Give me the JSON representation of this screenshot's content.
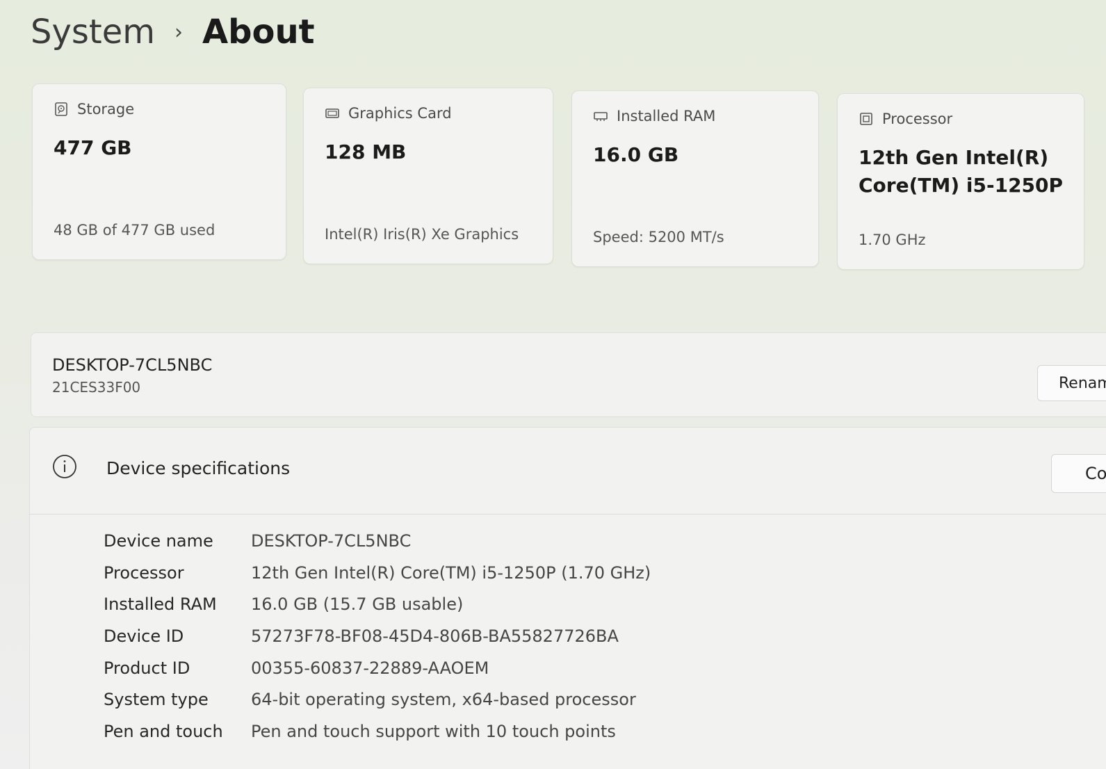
{
  "breadcrumb": {
    "parent": "System",
    "separator": "›",
    "current": "About"
  },
  "cards": [
    {
      "icon": "storage-icon",
      "label": "Storage",
      "value": "477 GB",
      "sub": "48 GB of 477 GB used"
    },
    {
      "icon": "graphics-card-icon",
      "label": "Graphics Card",
      "value": "128 MB",
      "sub": "Intel(R) Iris(R) Xe Graphics"
    },
    {
      "icon": "ram-icon",
      "label": "Installed RAM",
      "value": "16.0 GB",
      "sub": "Speed: 5200 MT/s"
    },
    {
      "icon": "processor-icon",
      "label": "Processor",
      "value_line1": "12th Gen Intel(R)",
      "value_line2": "Core(TM) i5-1250P",
      "sub": "1.70 GHz"
    }
  ],
  "device": {
    "name": "DESKTOP-7CL5NBC",
    "model": "21CES33F00",
    "rename_label": "Renam"
  },
  "specs": {
    "title": "Device specifications",
    "copy_label": "Co",
    "rows": [
      {
        "label": "Device name",
        "value": "DESKTOP-7CL5NBC"
      },
      {
        "label": "Processor",
        "value": "12th Gen Intel(R) Core(TM) i5-1250P (1.70 GHz)"
      },
      {
        "label": "Installed RAM",
        "value": "16.0 GB (15.7 GB usable)"
      },
      {
        "label": "Device ID",
        "value": "57273F78-BF08-45D4-806B-BA55827726BA"
      },
      {
        "label": "Product ID",
        "value": "00355-60837-22889-AAOEM"
      },
      {
        "label": "System type",
        "value": "64-bit operating system, x64-based processor"
      },
      {
        "label": "Pen and touch",
        "value": "Pen and touch support with 10 touch points"
      }
    ]
  }
}
